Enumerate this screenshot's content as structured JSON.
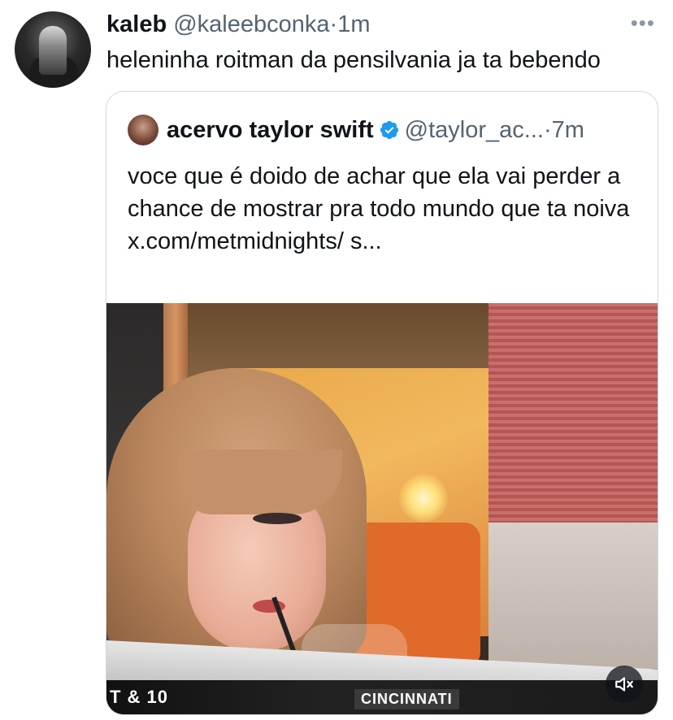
{
  "tweet": {
    "author_name": "kaleb",
    "author_handle": "@kaleebconka",
    "separator": "·",
    "time": "1m",
    "text": "heleninha roitman da pensilvania ja ta bebendo",
    "more_icon": "more-horizontal-icon"
  },
  "quoted_tweet": {
    "author_name": "acervo taylor swift",
    "verified": true,
    "verified_icon": "verified-badge-icon",
    "author_handle": "@taylor_ac...",
    "separator": "·",
    "time": "7m",
    "text": "voce que é doido de achar que ela vai perder a chance de mostrar pra todo mundo que ta noiva x.com/metmidnights/ s...",
    "media": {
      "type": "video",
      "overlay_score": "T & 10",
      "overlay_team": "CINCINNATI",
      "mute_icon": "volume-mute-icon"
    }
  },
  "colors": {
    "text_primary": "#0f1419",
    "text_secondary": "#536471",
    "verified_blue": "#1d9bf0",
    "border": "#cfd9de"
  }
}
